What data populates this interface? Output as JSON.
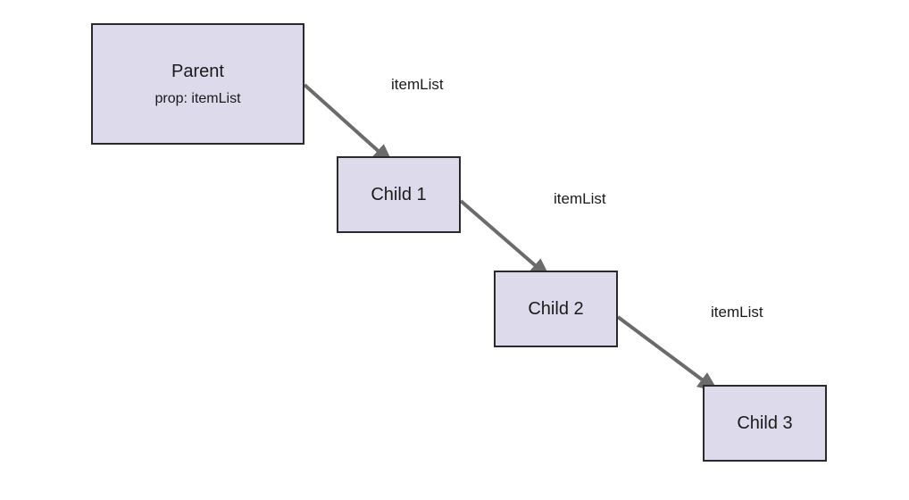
{
  "nodes": {
    "parent": {
      "title": "Parent",
      "subtitle": "prop: itemList"
    },
    "child1": {
      "title": "Child 1"
    },
    "child2": {
      "title": "Child 2"
    },
    "child3": {
      "title": "Child 3"
    }
  },
  "edges": {
    "e1": {
      "label": "itemList"
    },
    "e2": {
      "label": "itemList"
    },
    "e3": {
      "label": "itemList"
    }
  },
  "colors": {
    "nodeFill": "#dcdaeb",
    "nodeBorder": "#2a2a2a",
    "arrow": "#6b6b6b",
    "text": "#1a1a1a",
    "background": "#ffffff"
  }
}
